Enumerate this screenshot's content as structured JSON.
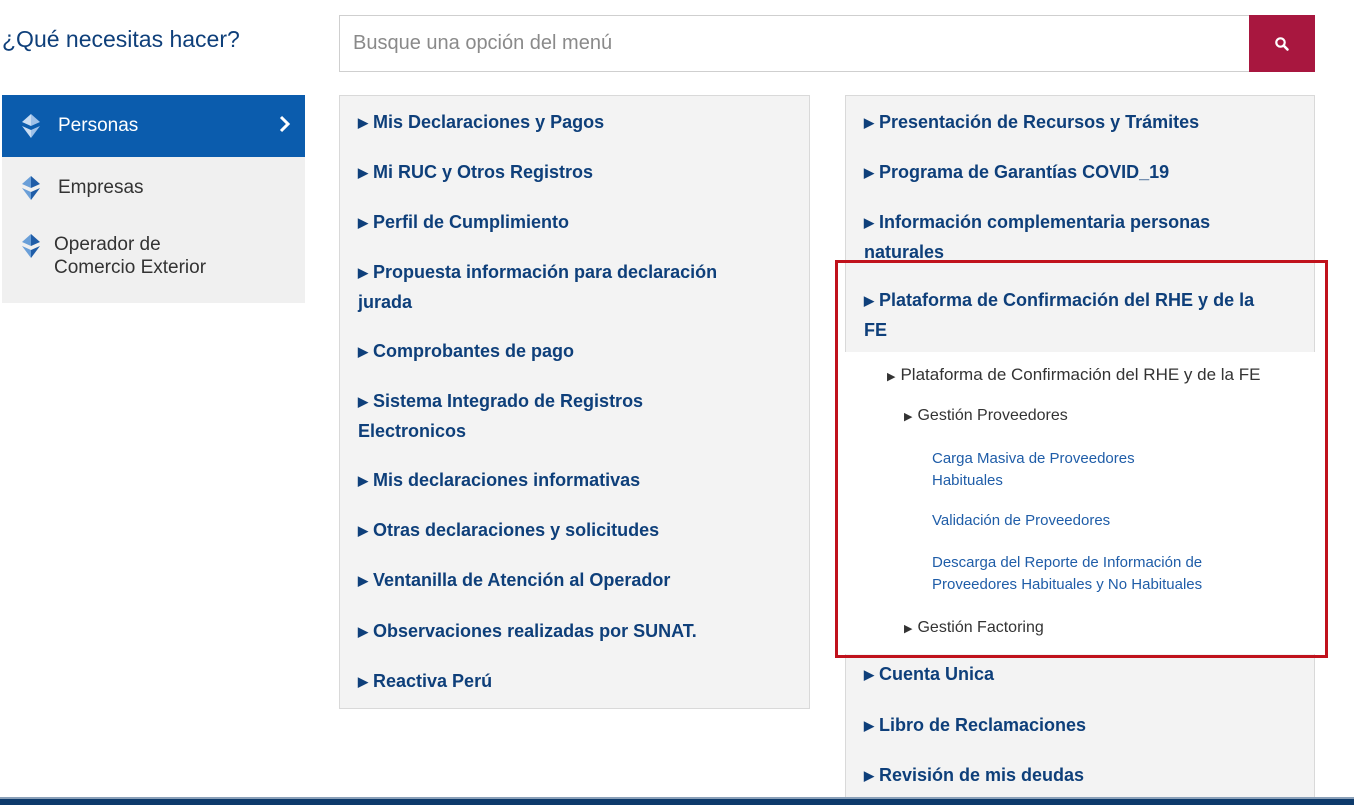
{
  "header": {
    "question": "¿Qué necesitas hacer?",
    "search_placeholder": "Busque una opción del menú"
  },
  "sidebar": {
    "items": [
      {
        "label": "Personas",
        "active": true
      },
      {
        "label": "Empresas",
        "active": false
      },
      {
        "label_line1": "Operador de",
        "label_line2": "Comercio Exterior",
        "active": false
      }
    ]
  },
  "column1": {
    "items": [
      {
        "label": "Mis Declaraciones y Pagos"
      },
      {
        "label": "Mi RUC y Otros Registros"
      },
      {
        "label": "Perfil de Cumplimiento"
      },
      {
        "line1": "Propuesta información para declaración",
        "line2": "jurada"
      },
      {
        "label": "Comprobantes de pago"
      },
      {
        "line1": "Sistema Integrado de Registros",
        "line2": "Electronicos"
      },
      {
        "label": "Mis declaraciones informativas"
      },
      {
        "label": "Otras declaraciones y solicitudes"
      },
      {
        "label": "Ventanilla de Atención al Operador"
      },
      {
        "label": "Observaciones realizadas por SUNAT."
      },
      {
        "label": "Reactiva Perú"
      }
    ]
  },
  "column2": {
    "items": [
      {
        "label": "Presentación de Recursos y Trámites"
      },
      {
        "label": "Programa de Garantías COVID_19"
      },
      {
        "line1": "Información complementaria personas",
        "line2": "naturales"
      },
      {
        "line1": "Plataforma de Confirmación del RHE y de la",
        "line2": "FE"
      }
    ],
    "submenu": {
      "title": "Plataforma de Confirmación del RHE y de la FE",
      "gestion_proveedores": "Gestión Proveedores",
      "links": [
        {
          "line1": "Carga Masiva de Proveedores",
          "line2": "Habituales"
        },
        {
          "label": "Validación de Proveedores"
        },
        {
          "line1": "Descarga del Reporte de Información de",
          "line2": "Proveedores Habituales y No Habituales"
        }
      ],
      "gestion_factoring": "Gestión Factoring"
    },
    "after_items": [
      {
        "label": "Cuenta Unica"
      },
      {
        "label": "Libro de Reclamaciones"
      },
      {
        "label": "Revisión de mis deudas"
      }
    ]
  },
  "colors": {
    "primary_blue": "#0b5cad",
    "search_button": "#a8173f",
    "highlight_border": "#c0121c",
    "link": "#1f5da8"
  }
}
